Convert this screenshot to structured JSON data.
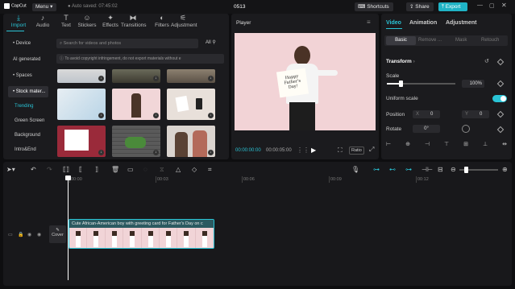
{
  "app": {
    "logo": "CapCut",
    "menu": "Menu",
    "autosave": "Auto saved: 07:45:02",
    "project": "0513",
    "shortcuts": "Shortcuts",
    "share": "Share",
    "export": "Export"
  },
  "tools": [
    {
      "label": "Import",
      "icon": "⤓"
    },
    {
      "label": "Audio",
      "icon": "♪"
    },
    {
      "label": "Text",
      "icon": "T"
    },
    {
      "label": "Stickers",
      "icon": "☺"
    },
    {
      "label": "Effects",
      "icon": "✦"
    },
    {
      "label": "Transitions",
      "icon": "⧓"
    },
    {
      "label": "Filters",
      "icon": "◐"
    },
    {
      "label": "Adjustment",
      "icon": "⚟"
    }
  ],
  "sidebar": {
    "items": [
      "• Device",
      "AI generated",
      "• Spaces",
      "• Stock mater..."
    ],
    "sub": [
      "Trending",
      "Green Screen",
      "Background",
      "Intro&End"
    ]
  },
  "media": {
    "search_placeholder": "Search for videos and photos",
    "all": "All",
    "notice": "To avoid copyright infringement, do not export materials without e"
  },
  "player": {
    "title": "Player",
    "time_current": "00:00:00:00",
    "time_total": "00:00:05:00",
    "ratio": "Ratio"
  },
  "card_text": {
    "happy": "Happy",
    "fathers": "Father's",
    "day": "Day!"
  },
  "props": {
    "tabs": [
      "Video",
      "Animation",
      "Adjustment"
    ],
    "subtabs": [
      "Basic",
      "Remove ...",
      "Mask",
      "Retouch"
    ],
    "transform": "Transform",
    "scale": "Scale",
    "scale_value": "100%",
    "uniform": "Uniform scale",
    "position": "Position",
    "x_label": "X",
    "x_value": "0",
    "y_label": "Y",
    "y_value": "0",
    "rotate": "Rotate",
    "rotate_value": "0°"
  },
  "timeline": {
    "ticks": [
      "00:00",
      "00:03",
      "00:06",
      "00:09",
      "00:12",
      "00:15"
    ],
    "clip_title": "Cute African-American boy with greeting card for Father's Day on c",
    "cover": "Cover"
  },
  "colors": {
    "accent": "#2ac4d6",
    "bg": "#0e0e10",
    "panel": "#1b1b1e"
  }
}
